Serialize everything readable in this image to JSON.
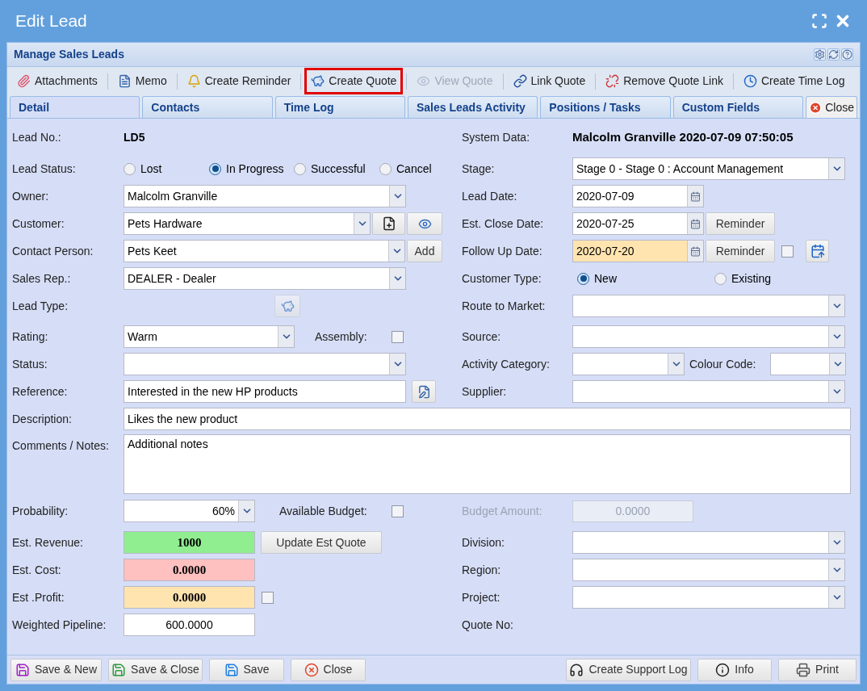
{
  "window": {
    "title": "Edit Lead"
  },
  "panel": {
    "title": "Manage Sales Leads"
  },
  "toolbar": [
    {
      "label": "Attachments",
      "disabled": false,
      "highlighted": false
    },
    {
      "label": "Memo",
      "disabled": false,
      "highlighted": false
    },
    {
      "label": "Create Reminder",
      "disabled": false,
      "highlighted": false
    },
    {
      "label": "Create Quote",
      "disabled": false,
      "highlighted": true
    },
    {
      "label": "View Quote",
      "disabled": true,
      "highlighted": false
    },
    {
      "label": "Link Quote",
      "disabled": false,
      "highlighted": false
    },
    {
      "label": "Remove Quote Link",
      "disabled": false,
      "highlighted": false
    },
    {
      "label": "Create Time Log",
      "disabled": false,
      "highlighted": false
    }
  ],
  "tabs": [
    {
      "label": "Detail",
      "selected": true
    },
    {
      "label": "Contacts",
      "selected": false
    },
    {
      "label": "Time Log",
      "selected": false
    },
    {
      "label": "Sales Leads Activity",
      "selected": false
    },
    {
      "label": "Positions / Tasks",
      "selected": false
    },
    {
      "label": "Custom Fields",
      "selected": false
    }
  ],
  "tab_close": "Close",
  "lead_no": {
    "label": "Lead No.:",
    "value": "LD5"
  },
  "lead_status": {
    "label": "Lead Status:",
    "options": [
      {
        "label": "Lost",
        "selected": false
      },
      {
        "label": "In Progress",
        "selected": true
      },
      {
        "label": "Successful",
        "selected": false
      },
      {
        "label": "Cancel",
        "selected": false
      }
    ]
  },
  "owner": {
    "label": "Owner:",
    "value": "Malcolm Granville"
  },
  "customer": {
    "label": "Customer:",
    "value": "Pets Hardware"
  },
  "contact_person": {
    "label": "Contact Person:",
    "value": "Pets Keet",
    "button": "Add"
  },
  "sales_rep": {
    "label": "Sales Rep.:",
    "value": "DEALER - Dealer"
  },
  "lead_type": {
    "label": "Lead Type:"
  },
  "rating": {
    "label": "Rating:",
    "value": "Warm"
  },
  "assembly": {
    "label": "Assembly:",
    "checked": false
  },
  "status": {
    "label": "Status:"
  },
  "reference": {
    "label": "Reference:",
    "value": "Interested in the new HP products"
  },
  "system_data": {
    "label": "System Data:",
    "value": "Malcolm Granville 2020-07-09 07:50:05"
  },
  "stage": {
    "label": "Stage:",
    "value": "Stage 0 - Stage 0 : Account Management"
  },
  "lead_date": {
    "label": "Lead Date:",
    "value": "2020-07-09"
  },
  "est_close_date": {
    "label": "Est. Close Date:",
    "value": "2020-07-25",
    "button": "Reminder"
  },
  "follow_up_date": {
    "label": "Follow Up Date:",
    "value": "2020-07-20",
    "button": "Reminder",
    "highlighted": true,
    "checked": false
  },
  "customer_type": {
    "label": "Customer Type:",
    "options": [
      {
        "label": "New",
        "selected": true
      },
      {
        "label": "Existing",
        "selected": false
      }
    ]
  },
  "route_to_market": {
    "label": "Route to Market:"
  },
  "source": {
    "label": "Source:"
  },
  "activity_category": {
    "label": "Activity Category:"
  },
  "colour_code": {
    "label": "Colour Code:"
  },
  "supplier": {
    "label": "Supplier:"
  },
  "description": {
    "label": "Description:",
    "value": "Likes the new product"
  },
  "comments": {
    "label": "Comments / Notes:",
    "value": "Additional notes"
  },
  "probability": {
    "label": "Probability:",
    "value": "60%"
  },
  "available_budget": {
    "label": "Available Budget:",
    "checked": false
  },
  "budget_amount": {
    "label": "Budget Amount:",
    "value": "0.0000",
    "disabled": true
  },
  "est_revenue": {
    "label": "Est. Revenue:",
    "value": "1000",
    "color": "#90ee90",
    "button": "Update Est Quote"
  },
  "est_cost": {
    "label": "Est. Cost:",
    "value": "0.0000",
    "color": "#ffc0c0"
  },
  "est_profit": {
    "label": "Est .Profit:",
    "value": "0.0000",
    "color": "#ffe4b0",
    "checked": false
  },
  "weighted_pipeline": {
    "label": "Weighted Pipeline:",
    "value": "600.0000"
  },
  "division": {
    "label": "Division:"
  },
  "region": {
    "label": "Region:"
  },
  "project": {
    "label": "Project:"
  },
  "quote_no": {
    "label": "Quote No:"
  },
  "footer": {
    "left": [
      "Save & New",
      "Save & Close",
      "Save",
      "Close"
    ],
    "right": [
      "Create Support Log",
      "Info",
      "Print"
    ]
  }
}
